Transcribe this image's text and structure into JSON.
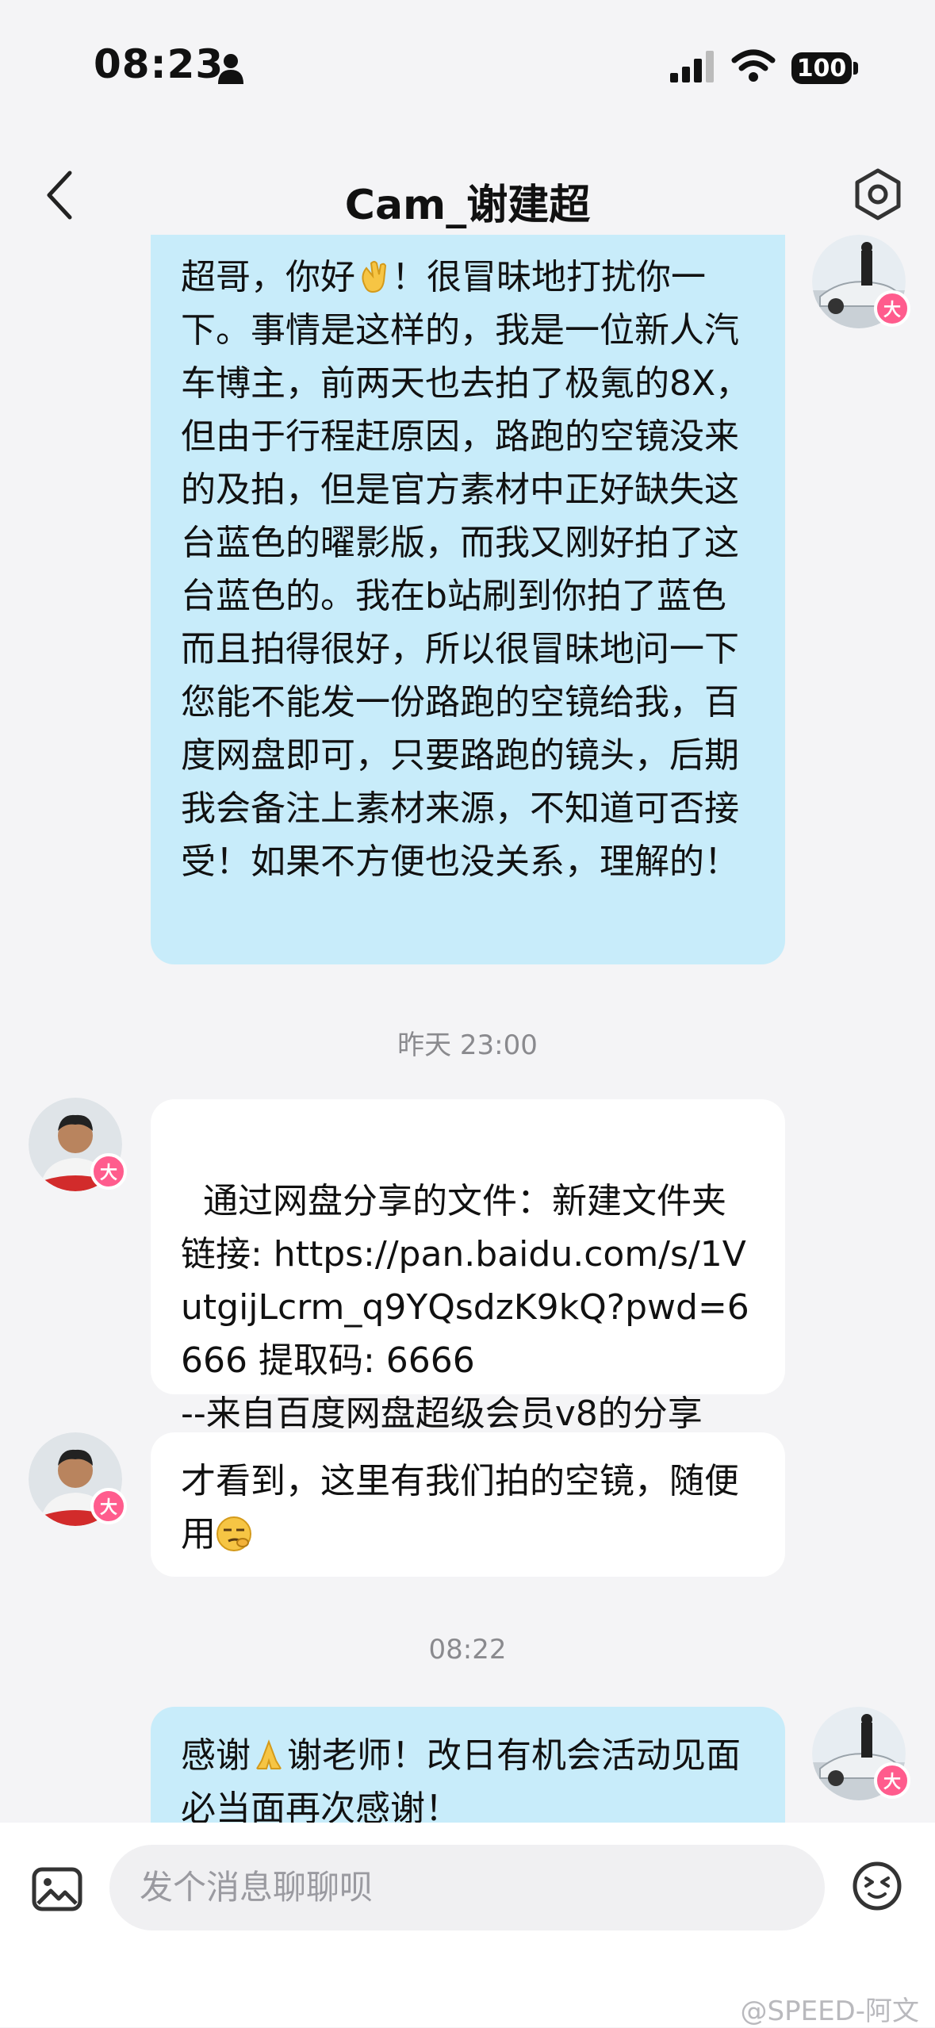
{
  "status_bar": {
    "time": "08:23",
    "battery": "100"
  },
  "header": {
    "title": "Cam_谢建超"
  },
  "messages": [
    {
      "from": "me",
      "text_before": "超哥，你好",
      "emoji": "waving-hand",
      "text": "！很冒昧地打扰你一下。事情是这样的，我是一位新人汽车博主，前两天也去拍了极氪的8X，但由于行程赶原因，路跑的空镜没来的及拍，但是官方素材中正好缺失这台蓝色的曜影版，而我又刚好拍了这台蓝色的。我在b站刷到你拍了蓝色而且拍得很好，所以很冒昧地问一下您能不能发一份路跑的空镜给我，百度网盘即可，只要路跑的镜头，后期我会备注上素材来源，不知道可否接受！如果不方便也没关系，理解的！"
    },
    {
      "type": "timestamp",
      "text": "昨天 23:00"
    },
    {
      "from": "them",
      "text": "通过网盘分享的文件：新建文件夹\n链接: https://pan.baidu.com/s/1VutgijLcrm_q9YQsdzK9kQ?pwd=6666 提取码: 6666\n--来自百度网盘超级会员v8的分享"
    },
    {
      "from": "them",
      "text": "才看到，这里有我们拍的空镜，随便用",
      "emoji": "smirk-face"
    },
    {
      "type": "timestamp",
      "text": "08:22"
    },
    {
      "from": "me",
      "text_before": "感谢",
      "emoji": "folded-hands",
      "text": "谢老师！改日有机会活动见面必当面再次感谢！"
    }
  ],
  "badge_label": "大",
  "input": {
    "placeholder": "发个消息聊聊呗"
  },
  "watermark": "@SPEED-阿文",
  "colors": {
    "my_bubble": "#c8ecfa",
    "their_bubble": "#ffffff",
    "badge": "#ff5c8d",
    "background": "#f4f4f6"
  }
}
